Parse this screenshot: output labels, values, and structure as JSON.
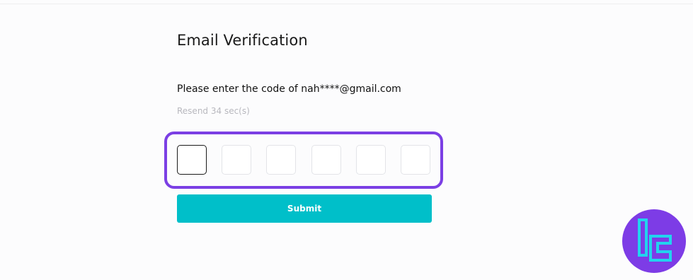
{
  "page": {
    "title": "Email Verification",
    "instruction": "Please enter the code of nah****@gmail.com",
    "resend": "Resend 34 sec(s)"
  },
  "code_input": {
    "length": 6,
    "values": [
      "",
      "",
      "",
      "",
      "",
      ""
    ],
    "active_index": 0
  },
  "actions": {
    "submit_label": "Submit"
  },
  "branding": {
    "logo_icon": "tradingfinder-logo-icon",
    "badge_color": "#7d3ce6",
    "logo_color": "#22d3ee"
  },
  "colors": {
    "accent_button": "#00bfc9",
    "highlight_border": "#7b3fe4",
    "muted_text": "#b8b8be"
  }
}
